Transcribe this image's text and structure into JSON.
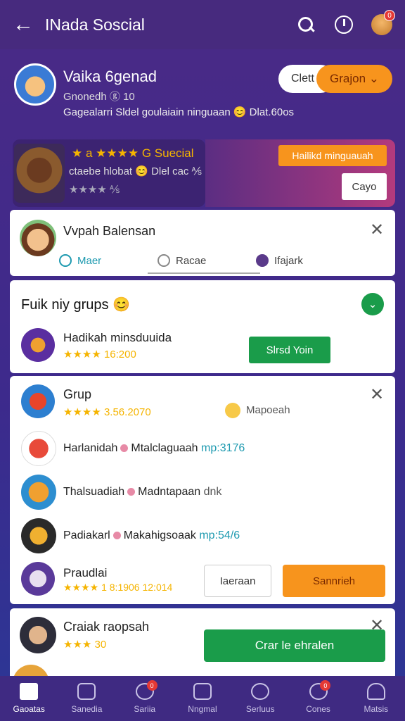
{
  "header": {
    "title": "INada Soscial",
    "back_icon": "←"
  },
  "profile": {
    "name": "Vaika 6genad",
    "sub": "Gnonedh ⓖ 10",
    "line": "Gagealarri Sldel goulaiain ninguaan 😊 Dlat.60os",
    "get_label": "Clett",
    "group_label": "Grajon ⌄"
  },
  "promo": {
    "title": "★ a ★★★★ G Suecial",
    "subtitle": "ctaebe hlobat 😊 Dlel cac ⅍",
    "rating": "★★★★ ⅍",
    "hot_label": "Hailikd minguauah",
    "copy_label": "Cayo"
  },
  "card1": {
    "name": "Vvpah Balensan",
    "tabs": [
      "Maer",
      "Racae",
      "Ifajark"
    ]
  },
  "card2": {
    "heading": "Fuik niy grups 😊",
    "group_name": "Hadikah minsduuida",
    "group_stars": "★★★★ 16:200",
    "join_label": "Slrsd Yoin",
    "check_icon": "⌄"
  },
  "card3": {
    "title": "Grup",
    "stars": "★★★★ 3.56.2070",
    "extra": "Mapoeah",
    "rows": [
      {
        "name": "Harlanidah",
        "detail": "Mtalclaguaah",
        "tag": "mp:3176"
      },
      {
        "name": "Thalsuadiah",
        "detail": "Madntapaan",
        "tag": "dnk"
      },
      {
        "name": "Padiakarl",
        "detail": "Makahigsoaak",
        "tag": "mp:54/6"
      }
    ],
    "last_name": "Praudlai",
    "last_stars": "★★★★ 1 8:1906 12:014",
    "btn_light": "Iaeraan",
    "btn_orange": "Sannrieh"
  },
  "card4": {
    "name": "Craiak raopsah",
    "stars": "★★★ 30",
    "button": "Crar le ehralen"
  },
  "nav": [
    {
      "label": "Gaoatas",
      "active": true
    },
    {
      "label": "Sanedia"
    },
    {
      "label": "Sariia",
      "badge": "0"
    },
    {
      "label": "Nngmal"
    },
    {
      "label": "Serluus"
    },
    {
      "label": "Cones",
      "badge": "0"
    },
    {
      "label": "Matsis"
    }
  ],
  "top_badge": "0",
  "colors": {
    "accent": "#f7941d",
    "green": "#1a9c4a",
    "bg": "#472a7e"
  }
}
